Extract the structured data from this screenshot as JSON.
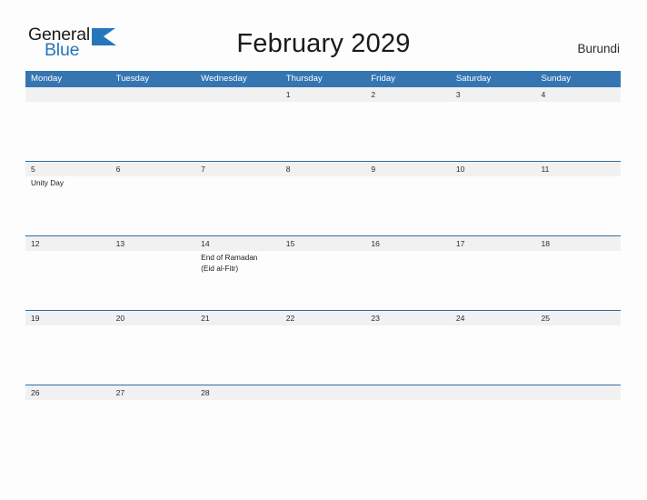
{
  "brand": {
    "name_part1": "General",
    "name_part2": "Blue",
    "mark": "triangle-flag-icon",
    "color_dark": "#1b1b1b",
    "color_blue": "#2576bd"
  },
  "header": {
    "title": "February 2029",
    "country": "Burundi"
  },
  "theme": {
    "header_blue": "#3575B2",
    "row_divider_blue": "#2E6DA4",
    "date_band_gray": "#F1F1F1",
    "page_background": "#FDFDFD"
  },
  "calendar": {
    "month": "February",
    "year": "2029",
    "weekday_headers": [
      "Monday",
      "Tuesday",
      "Wednesday",
      "Thursday",
      "Friday",
      "Saturday",
      "Sunday"
    ],
    "weeks": [
      [
        {
          "date": "",
          "events": []
        },
        {
          "date": "",
          "events": []
        },
        {
          "date": "",
          "events": []
        },
        {
          "date": "1",
          "events": []
        },
        {
          "date": "2",
          "events": []
        },
        {
          "date": "3",
          "events": []
        },
        {
          "date": "4",
          "events": []
        }
      ],
      [
        {
          "date": "5",
          "events": [
            "Unity Day"
          ]
        },
        {
          "date": "6",
          "events": []
        },
        {
          "date": "7",
          "events": []
        },
        {
          "date": "8",
          "events": []
        },
        {
          "date": "9",
          "events": []
        },
        {
          "date": "10",
          "events": []
        },
        {
          "date": "11",
          "events": []
        }
      ],
      [
        {
          "date": "12",
          "events": []
        },
        {
          "date": "13",
          "events": []
        },
        {
          "date": "14",
          "events": [
            "End of Ramadan",
            "(Eid al-Fitr)"
          ]
        },
        {
          "date": "15",
          "events": []
        },
        {
          "date": "16",
          "events": []
        },
        {
          "date": "17",
          "events": []
        },
        {
          "date": "18",
          "events": []
        }
      ],
      [
        {
          "date": "19",
          "events": []
        },
        {
          "date": "20",
          "events": []
        },
        {
          "date": "21",
          "events": []
        },
        {
          "date": "22",
          "events": []
        },
        {
          "date": "23",
          "events": []
        },
        {
          "date": "24",
          "events": []
        },
        {
          "date": "25",
          "events": []
        }
      ],
      [
        {
          "date": "26",
          "events": []
        },
        {
          "date": "27",
          "events": []
        },
        {
          "date": "28",
          "events": []
        },
        {
          "date": "",
          "events": []
        },
        {
          "date": "",
          "events": []
        },
        {
          "date": "",
          "events": []
        },
        {
          "date": "",
          "events": []
        }
      ]
    ]
  }
}
